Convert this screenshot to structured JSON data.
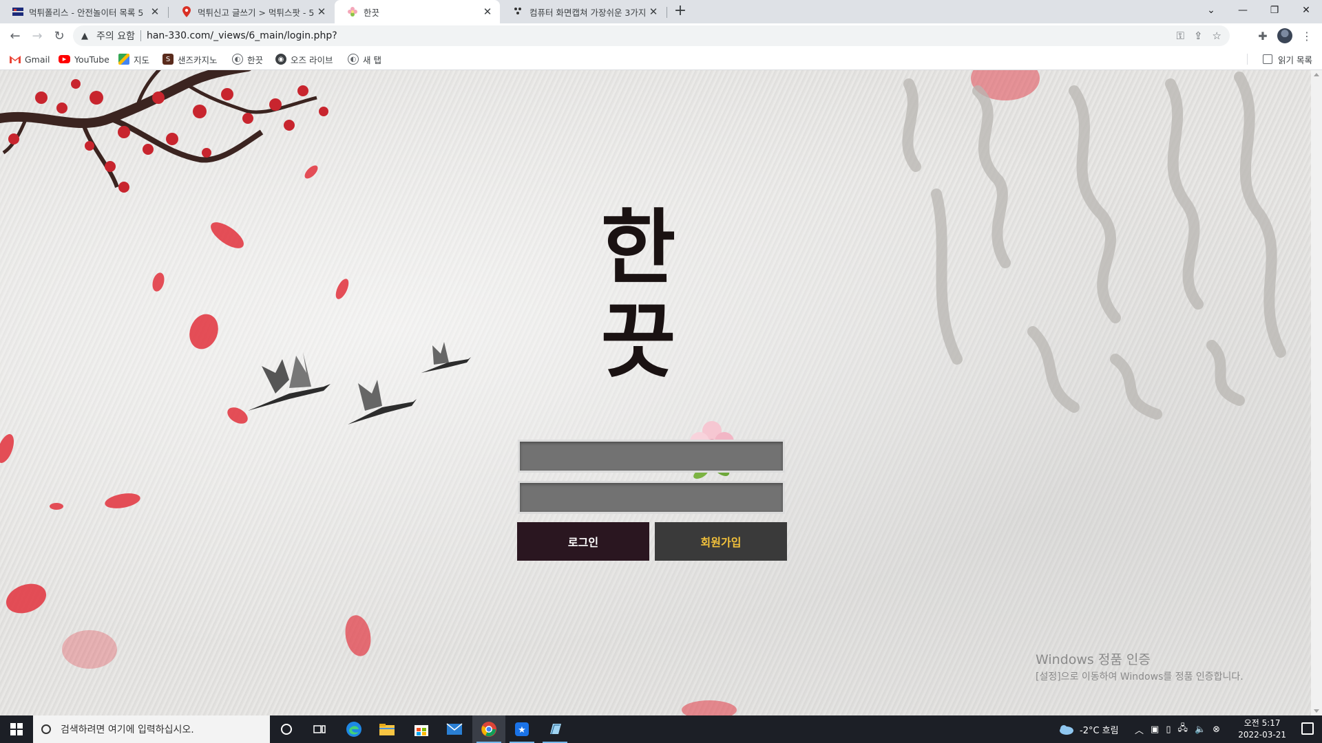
{
  "tabs": [
    {
      "title": "먹튀폴리스 - 안전놀이터 목록 5",
      "active": false
    },
    {
      "title": "먹튀신고 글쓰기 > 먹튀스팟 - 5",
      "active": false
    },
    {
      "title": "한끗",
      "active": true
    },
    {
      "title": "컴퓨터 화면캡쳐 가장쉬운 3가지",
      "active": false
    }
  ],
  "toolbar": {
    "security_text": "주의 요함",
    "url": "han-330.com/_views/6_main/login.php?"
  },
  "bookmarks": [
    {
      "label": "Gmail",
      "icon": "gmail-icon",
      "color": "#ea4335"
    },
    {
      "label": "YouTube",
      "icon": "youtube-icon",
      "color": "#ff0000"
    },
    {
      "label": "지도",
      "icon": "maps-icon",
      "color": "#34a853"
    },
    {
      "label": "샌즈카지노",
      "icon": "sands-casino-icon",
      "color": "#5a2b1c"
    },
    {
      "label": "한끗",
      "icon": "globe-icon",
      "color": "#5f6368"
    },
    {
      "label": "오즈 라이브",
      "icon": "oz-live-icon",
      "color": "#3c4043"
    },
    {
      "label": "새 탭",
      "icon": "globe-icon",
      "color": "#5f6368"
    }
  ],
  "reading_list": "읽기 목록",
  "page": {
    "logo_text": "한끗",
    "username_placeholder": "",
    "password_placeholder": "",
    "login_label": "로그인",
    "join_label": "회원가입",
    "colors": {
      "login_bg": "#2a1620",
      "join_bg": "#3a3a3a",
      "join_text": "#f2c13b"
    }
  },
  "activation": {
    "title": "Windows 정품 인증",
    "subtitle": "[설정]으로 이동하여 Windows를 정품 인증합니다."
  },
  "taskbar": {
    "search_placeholder": "검색하려면 여기에 입력하십시오.",
    "weather": "-2°C  흐림",
    "time": "오전 5:17",
    "date": "2022-03-21"
  }
}
